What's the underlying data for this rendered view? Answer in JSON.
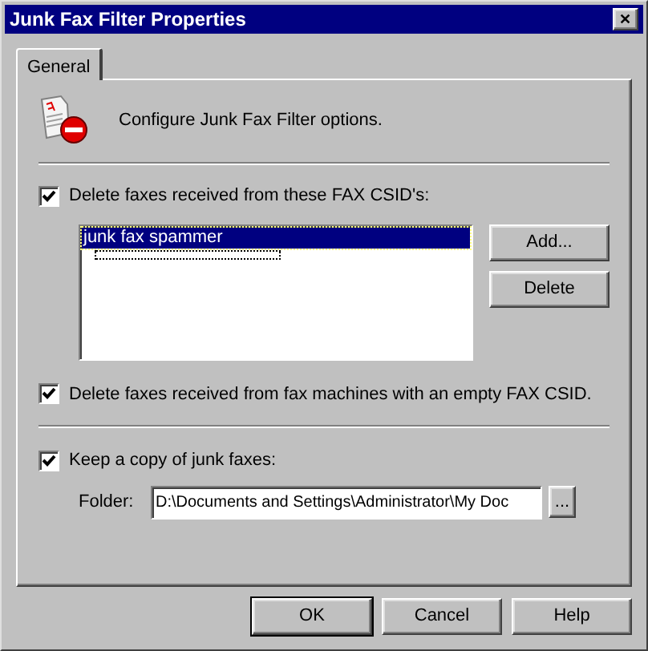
{
  "window": {
    "title": "Junk Fax Filter Properties",
    "close": "✕"
  },
  "tabs": [
    {
      "label": "General",
      "selected": true
    }
  ],
  "header": {
    "text": "Configure Junk Fax Filter options."
  },
  "csid_filter": {
    "label": "Delete faxes received from these FAX CSID's:",
    "checked": true,
    "list": [
      {
        "text": "junk fax spammer",
        "selected": true
      }
    ],
    "buttons": [
      "Add...",
      "Delete"
    ]
  },
  "empty_csid": {
    "label": "Delete faxes received from fax machines with an empty FAX CSID.",
    "checked": true
  },
  "keep_copy": {
    "label": "Keep a copy of junk faxes:",
    "checked": true,
    "folder_label": "Folder:",
    "folder_value": "D:\\Documents and Settings\\Administrator\\My Doc",
    "browse": "..."
  },
  "buttons": [
    {
      "label": "OK",
      "default": true
    },
    {
      "label": "Cancel",
      "default": false
    },
    {
      "label": "Help",
      "default": false
    }
  ]
}
